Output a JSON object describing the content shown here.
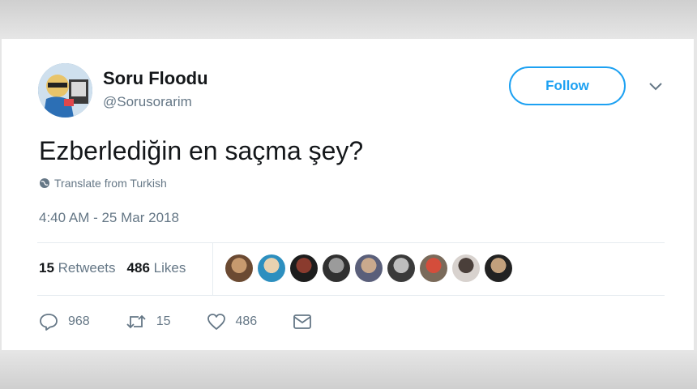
{
  "user": {
    "name": "Soru Floodu",
    "handle": "@Sorusorarim"
  },
  "follow_label": "Follow",
  "tweet": {
    "text": "Ezberlediğin en saçma şey?",
    "translate_label": "Translate from Turkish",
    "timestamp": "4:40 AM - 25 Mar 2018"
  },
  "stats": {
    "retweets_count": "15",
    "retweets_label": "Retweets",
    "likes_count": "486",
    "likes_label": "Likes"
  },
  "likers": [
    {
      "color": "#6b4a32",
      "accent": "#c79a6e"
    },
    {
      "color": "#2d8fbf",
      "accent": "#e8d2b0"
    },
    {
      "color": "#1d1d1d",
      "accent": "#8a3b2e"
    },
    {
      "color": "#303030",
      "accent": "#9b9b9b"
    },
    {
      "color": "#5a5f7a",
      "accent": "#c9a98d"
    },
    {
      "color": "#3a3a3a",
      "accent": "#bdbdbd"
    },
    {
      "color": "#7a6a5a",
      "accent": "#d44d3b"
    },
    {
      "color": "#d8d2ce",
      "accent": "#4a3f3a"
    },
    {
      "color": "#222222",
      "accent": "#c2a07c"
    }
  ],
  "actions": {
    "replies": "968",
    "retweets": "15",
    "likes": "486"
  },
  "colors": {
    "accent": "#1da1f2",
    "text": "#14171a",
    "secondary": "#657786"
  }
}
